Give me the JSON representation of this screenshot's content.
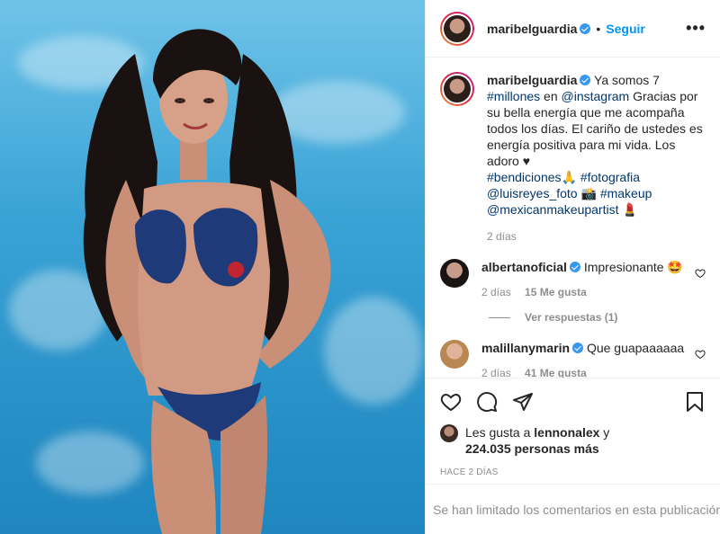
{
  "post": {
    "author": "maribelguardia",
    "follow_label": "Seguir",
    "more_label": "•••",
    "caption": {
      "username": "maribelguardia",
      "text_1": "Ya somos 7 ",
      "hashtag_1": "#millones",
      "text_2": " en ",
      "mention_1": "@instagram",
      "text_3": " Gracias por su bella energía que me acompaña todos los días. El cariño de ustedes es energía positiva para mi vida. Los adoro ♥",
      "hashtag_2": "#bendiciones",
      "emoji_1": "🙏",
      "hashtag_3": "#fotografia",
      "mention_2": "@luisreyes_foto",
      "emoji_2": "📸",
      "hashtag_4": "#makeup",
      "mention_3": "@mexicanmakeupartist",
      "emoji_3": "💄",
      "time": "2 días"
    },
    "comments": [
      {
        "username": "albertanoficial",
        "text": "Impresionante 🤩",
        "time": "2 días",
        "likes": "15 Me gusta",
        "replies": "Ver respuestas (1)"
      },
      {
        "username": "malillanymarin",
        "text": "Que guapaaaaaa",
        "time": "2 días",
        "likes": "41 Me gusta"
      }
    ],
    "likes_text_prefix": "Les gusta a ",
    "likes_user": "lennonalex",
    "likes_text_mid": " y",
    "likes_count": "224.035 personas más",
    "date": "HACE 2 DÍAS",
    "comments_limited": "Se han limitado los comentarios en esta publicación."
  }
}
